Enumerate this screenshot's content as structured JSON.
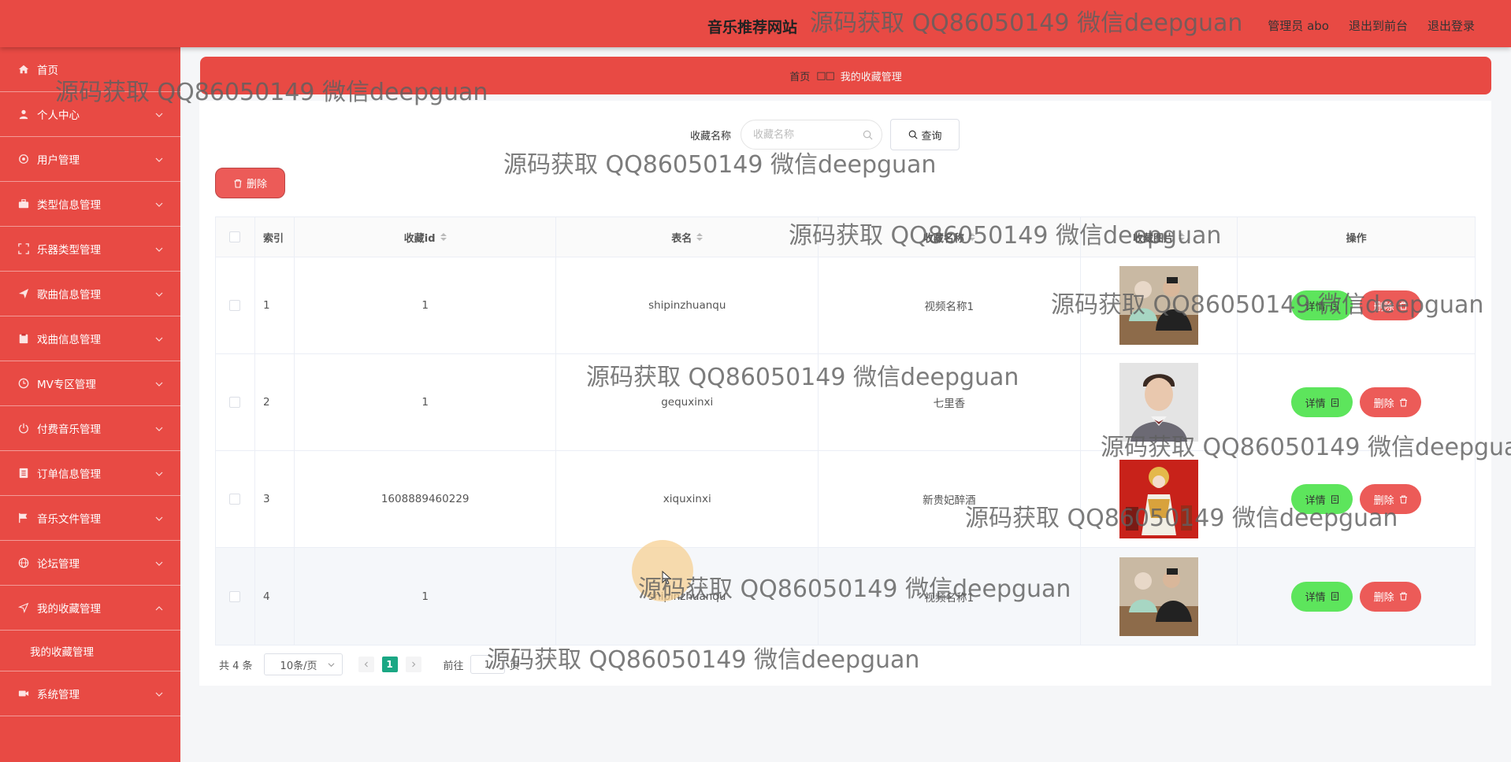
{
  "header": {
    "site_title": "音乐推荐网站",
    "admin": "管理员 abo",
    "back_to_front": "退出到前台",
    "logout": "退出登录"
  },
  "sidebar": {
    "items": [
      {
        "label": "首页",
        "icon": "home-icon"
      },
      {
        "label": "个人中心",
        "icon": "user-icon"
      },
      {
        "label": "用户管理",
        "icon": "user-gear-icon"
      },
      {
        "label": "类型信息管理",
        "icon": "briefcase-icon"
      },
      {
        "label": "乐器类型管理",
        "icon": "fullscreen-icon"
      },
      {
        "label": "歌曲信息管理",
        "icon": "send-icon"
      },
      {
        "label": "戏曲信息管理",
        "icon": "clipboard-icon"
      },
      {
        "label": "MV专区管理",
        "icon": "clock-icon"
      },
      {
        "label": "付费音乐管理",
        "icon": "power-icon"
      },
      {
        "label": "订单信息管理",
        "icon": "list-icon"
      },
      {
        "label": "音乐文件管理",
        "icon": "flag-icon"
      },
      {
        "label": "论坛管理",
        "icon": "globe-icon"
      },
      {
        "label": "我的收藏管理",
        "icon": "navigation-icon"
      },
      {
        "label": "系统管理",
        "icon": "video-icon"
      }
    ],
    "sub_item": "我的收藏管理"
  },
  "breadcrumb": {
    "home": "首页",
    "separator": "□□",
    "current": "我的收藏管理"
  },
  "search": {
    "label": "收藏名称",
    "placeholder": "收藏名称",
    "button": "查询"
  },
  "toolbar": {
    "delete_label": "删除"
  },
  "table": {
    "headers": {
      "index": "索引",
      "fav_id": "收藏id",
      "table_name": "表名",
      "fav_name": "收藏名称",
      "fav_image": "收藏图片",
      "actions": "操作"
    },
    "rows": [
      {
        "index": "1",
        "fav_id": "1",
        "table_name": "shipinzhuanqu",
        "fav_name": "视频名称1",
        "image": "two-people-photo"
      },
      {
        "index": "2",
        "fav_id": "1",
        "table_name": "gequxinxi",
        "fav_name": "七里香",
        "image": "singer-portrait"
      },
      {
        "index": "3",
        "fav_id": "1608889460229",
        "table_name": "xiquxinxi",
        "fav_name": "新贵妃醉酒",
        "image": "opera-performer"
      },
      {
        "index": "4",
        "fav_id": "1",
        "table_name": "shipinzhuanqu",
        "fav_name": "视频名称1",
        "image": "two-people-photo"
      }
    ],
    "detail_label": "详情",
    "remove_label": "删除"
  },
  "pagination": {
    "total": "共 4 条",
    "page_size": "10条/页",
    "current_page": "1",
    "goto_label": "前往",
    "goto_value": "1",
    "goto_suffix": "页"
  },
  "watermark": "源码获取 QQ86050149 微信deepguan",
  "colors": {
    "primary_red": "#e84a44",
    "detail_green": "#5de55c",
    "remove_red": "#ec5b58",
    "page_active": "#1ba784"
  }
}
